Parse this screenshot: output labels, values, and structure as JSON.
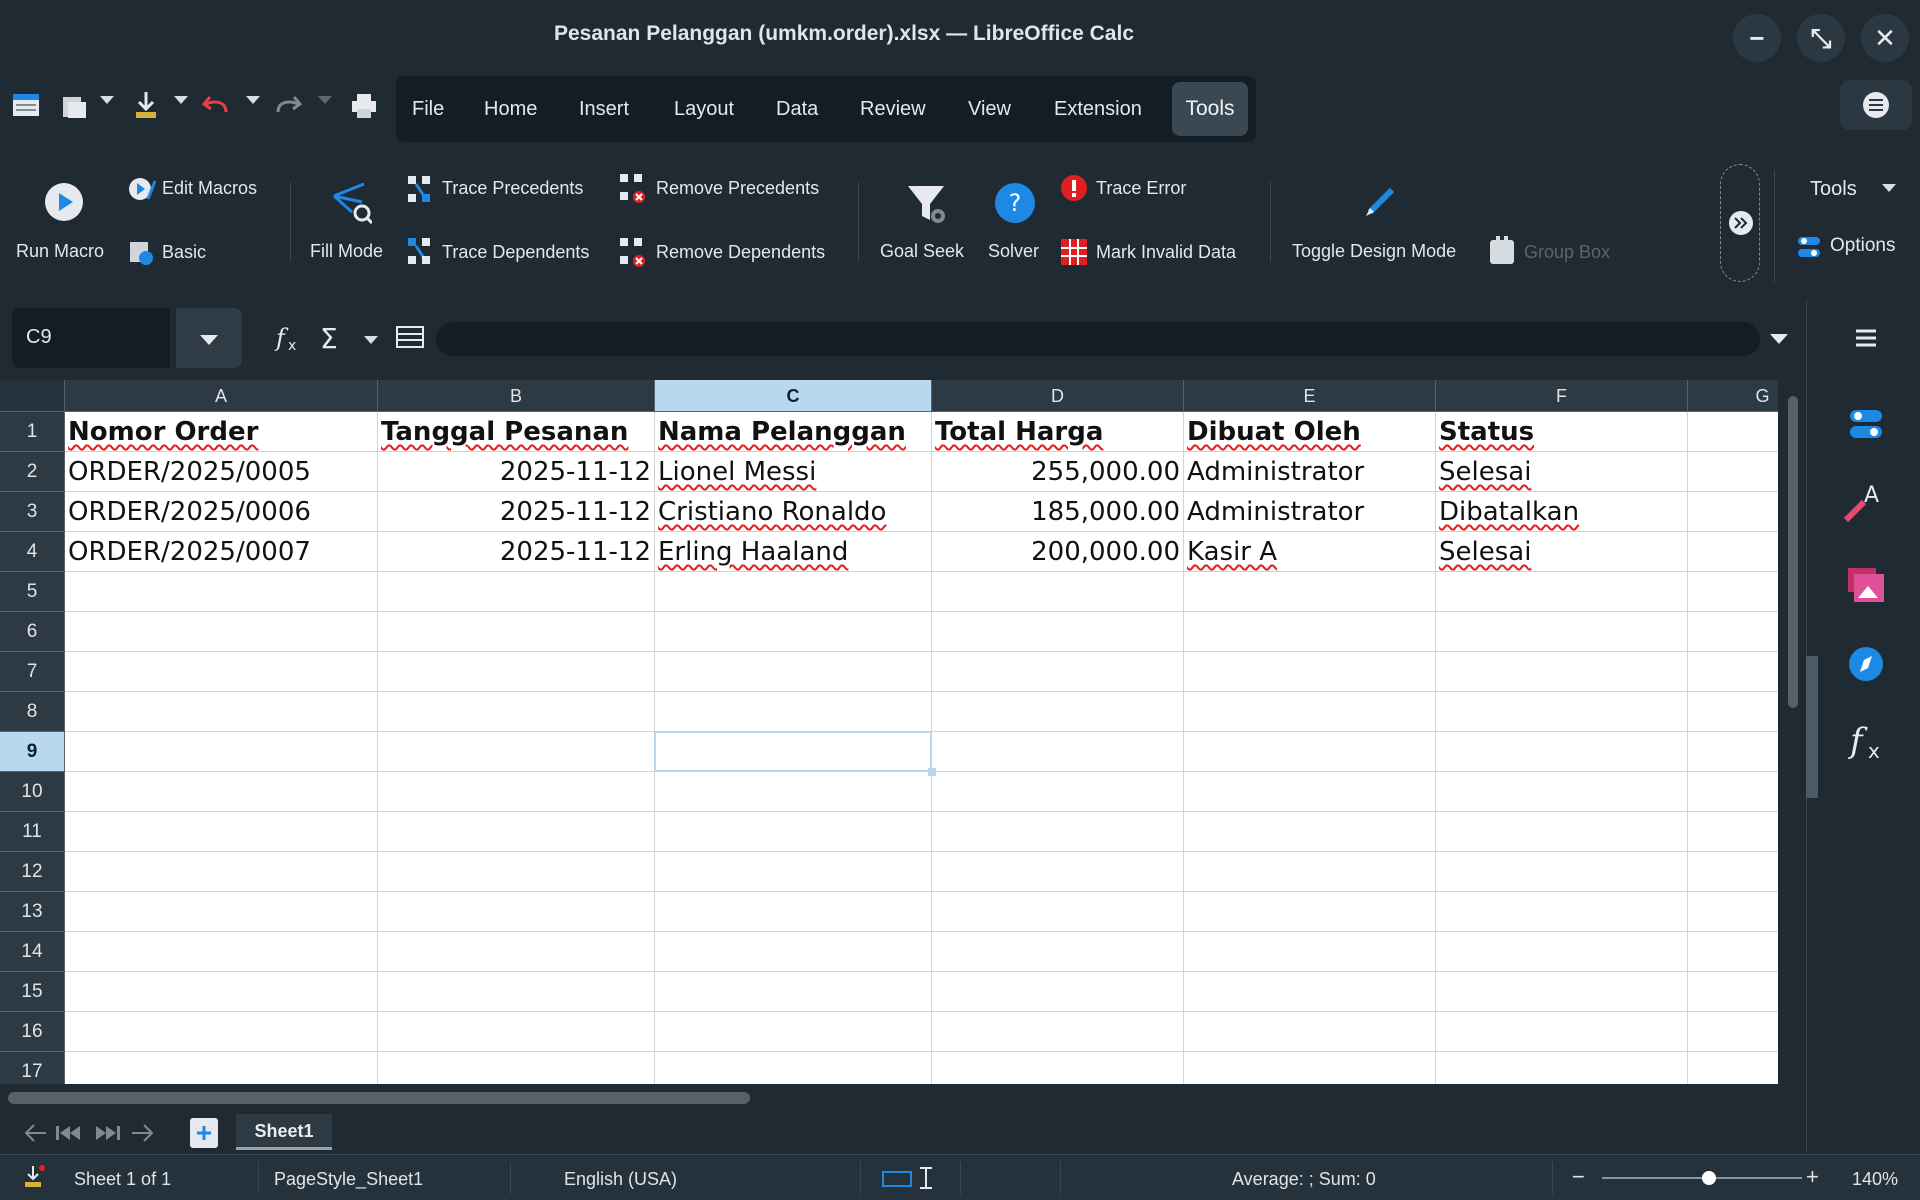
{
  "window": {
    "title": "Pesanan Pelanggan (umkm.order).xlsx — LibreOffice Calc",
    "minimize": "−",
    "restore": "⤡",
    "close": "✕"
  },
  "menubar": {
    "items": [
      "File",
      "Home",
      "Insert",
      "Layout",
      "Data",
      "Review",
      "View",
      "Extension"
    ],
    "active": "Tools"
  },
  "ribbon": {
    "run_macro": "Run Macro",
    "edit_macros": "Edit Macros",
    "basic": "Basic",
    "fill_mode": "Fill Mode",
    "trace_precedents": "Trace Precedents",
    "trace_dependents": "Trace Dependents",
    "remove_precedents": "Remove Precedents",
    "remove_dependents": "Remove Dependents",
    "goal_seek": "Goal Seek",
    "solver": "Solver",
    "trace_error": "Trace Error",
    "mark_invalid": "Mark Invalid Data",
    "toggle_design": "Toggle Design Mode",
    "group_box": "Group Box",
    "tools_dropdown": "Tools",
    "options": "Options"
  },
  "formula_bar": {
    "name_box": "C9",
    "formula": ""
  },
  "sheet": {
    "columns": [
      "A",
      "B",
      "C",
      "D",
      "E",
      "F",
      "G"
    ],
    "selected_column": "C",
    "rows": [
      "1",
      "2",
      "3",
      "4",
      "5",
      "6",
      "7",
      "8",
      "9",
      "10",
      "11",
      "12",
      "13",
      "14",
      "15",
      "16",
      "17"
    ],
    "selected_row": "9",
    "header": [
      "Nomor Order",
      "Tanggal Pesanan",
      "Nama Pelanggan",
      "Total Harga",
      "Dibuat Oleh",
      "Status"
    ],
    "data": [
      [
        "ORDER/2025/0005",
        "2025-11-12",
        "Lionel Messi",
        "255,000.00",
        "Administrator",
        "Selesai"
      ],
      [
        "ORDER/2025/0006",
        "2025-11-12",
        "Cristiano Ronaldo",
        "185,000.00",
        "Administrator",
        "Dibatalkan"
      ],
      [
        "ORDER/2025/0007",
        "2025-11-12",
        "Erling Haaland",
        "200,000.00",
        "Kasir A",
        "Selesai"
      ]
    ]
  },
  "tabs": {
    "sheet_name": "Sheet1"
  },
  "status": {
    "sheet_of": "Sheet 1 of 1",
    "page_style": "PageStyle_Sheet1",
    "language": "English (USA)",
    "summary": "Average: ; Sum: 0",
    "zoom": "140%",
    "zoom_minus": "−",
    "zoom_plus": "+"
  },
  "colors": {
    "background": "#1f2a33",
    "accent_blue": "#1e88e5",
    "selection": "#b8d8f0",
    "spell_error": "#e02020"
  }
}
